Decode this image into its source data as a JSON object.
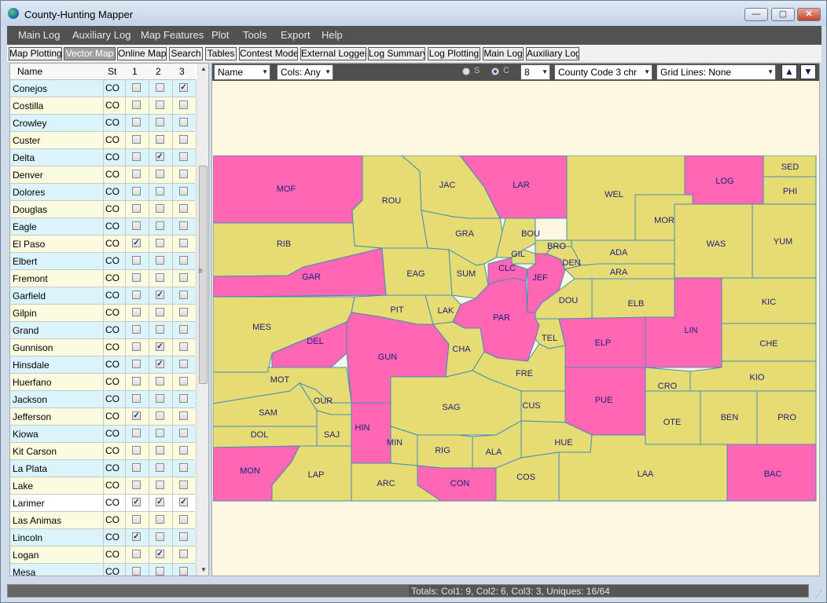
{
  "window": {
    "title": "County-Hunting Mapper",
    "min": "—",
    "max": "▢",
    "close": "✕"
  },
  "menu": [
    "Main Log",
    "Auxiliary Log",
    "Map Features",
    "Plot",
    "Tools",
    "Export",
    "Help"
  ],
  "tabs": [
    "Map Plotting",
    "Vector Map",
    "Online Map",
    "Search",
    "Tables",
    "Contest Mode",
    "External Logger",
    "Log Summary",
    "Log Plotting",
    "Main Log",
    "Auxiliary Log"
  ],
  "active_tab": "Vector Map",
  "table": {
    "headers": [
      "Name",
      "St",
      "1",
      "2",
      "3"
    ],
    "rows": [
      {
        "name": "Conejos",
        "st": "CO",
        "c1": false,
        "c2": false,
        "c3": true
      },
      {
        "name": "Costilla",
        "st": "CO",
        "c1": false,
        "c2": false,
        "c3": false
      },
      {
        "name": "Crowley",
        "st": "CO",
        "c1": false,
        "c2": false,
        "c3": false
      },
      {
        "name": "Custer",
        "st": "CO",
        "c1": false,
        "c2": false,
        "c3": false
      },
      {
        "name": "Delta",
        "st": "CO",
        "c1": false,
        "c2": true,
        "c3": false
      },
      {
        "name": "Denver",
        "st": "CO",
        "c1": false,
        "c2": false,
        "c3": false
      },
      {
        "name": "Dolores",
        "st": "CO",
        "c1": false,
        "c2": false,
        "c3": false
      },
      {
        "name": "Douglas",
        "st": "CO",
        "c1": false,
        "c2": false,
        "c3": false
      },
      {
        "name": "Eagle",
        "st": "CO",
        "c1": false,
        "c2": false,
        "c3": false
      },
      {
        "name": "El Paso",
        "st": "CO",
        "c1": true,
        "c2": false,
        "c3": false
      },
      {
        "name": "Elbert",
        "st": "CO",
        "c1": false,
        "c2": false,
        "c3": false
      },
      {
        "name": "Fremont",
        "st": "CO",
        "c1": false,
        "c2": false,
        "c3": false
      },
      {
        "name": "Garfield",
        "st": "CO",
        "c1": false,
        "c2": true,
        "c3": false
      },
      {
        "name": "Gilpin",
        "st": "CO",
        "c1": false,
        "c2": false,
        "c3": false
      },
      {
        "name": "Grand",
        "st": "CO",
        "c1": false,
        "c2": false,
        "c3": false
      },
      {
        "name": "Gunnison",
        "st": "CO",
        "c1": false,
        "c2": true,
        "c3": false
      },
      {
        "name": "Hinsdale",
        "st": "CO",
        "c1": false,
        "c2": true,
        "c3": false
      },
      {
        "name": "Huerfano",
        "st": "CO",
        "c1": false,
        "c2": false,
        "c3": false
      },
      {
        "name": "Jackson",
        "st": "CO",
        "c1": false,
        "c2": false,
        "c3": false
      },
      {
        "name": "Jefferson",
        "st": "CO",
        "c1": true,
        "c2": false,
        "c3": false
      },
      {
        "name": "Kiowa",
        "st": "CO",
        "c1": false,
        "c2": false,
        "c3": false
      },
      {
        "name": "Kit Carson",
        "st": "CO",
        "c1": false,
        "c2": false,
        "c3": false
      },
      {
        "name": "La Plata",
        "st": "CO",
        "c1": false,
        "c2": false,
        "c3": false
      },
      {
        "name": "Lake",
        "st": "CO",
        "c1": false,
        "c2": false,
        "c3": false
      },
      {
        "name": "Larimer",
        "st": "CO",
        "c1": true,
        "c2": true,
        "c3": true
      },
      {
        "name": "Las Animas",
        "st": "CO",
        "c1": false,
        "c2": false,
        "c3": false
      },
      {
        "name": "Lincoln",
        "st": "CO",
        "c1": true,
        "c2": false,
        "c3": false
      },
      {
        "name": "Logan",
        "st": "CO",
        "c1": false,
        "c2": true,
        "c3": false
      },
      {
        "name": "Mesa",
        "st": "CO",
        "c1": false,
        "c2": false,
        "c3": false
      }
    ]
  },
  "map_toolbar": {
    "name_dropdown": "Name",
    "cols_dropdown": "Cols: Any",
    "radio_s": "S",
    "radio_c": "C",
    "radio_selected": "C",
    "size_dropdown": "8",
    "code_dropdown": "County Code 3 chr",
    "grid_dropdown": "Grid Lines: None",
    "up_btn": "▲",
    "down_btn": "▼"
  },
  "colors": {
    "worked": "#ff66b3",
    "unworked": "#e6dc73",
    "border": "#3f8fb8",
    "label": "#1e1e7a",
    "map_bg": "#fdf7e2"
  },
  "map_counties": [
    "MOF",
    "ROU",
    "JAC",
    "LAR",
    "WEL",
    "LOG",
    "SED",
    "PHI",
    "MOR",
    "RIB",
    "GRA",
    "BOU",
    "BRO",
    "ADA",
    "WAS",
    "YUM",
    "GAR",
    "EAG",
    "SUM",
    "GIL",
    "CLC",
    "DEN",
    "JEF",
    "ARA",
    "MES",
    "PIT",
    "LAK",
    "DOU",
    "ELB",
    "KIC",
    "DEL",
    "PAR",
    "LIN",
    "GUN",
    "CHA",
    "TEL",
    "ELP",
    "CHE",
    "FRE",
    "MOT",
    "KIO",
    "OUR",
    "CUS",
    "PUE",
    "CRO",
    "SAG",
    "SAM",
    "SAJ",
    "HIN",
    "OTE",
    "BEN",
    "PRO",
    "DOL",
    "MIN",
    "RIG",
    "ALA",
    "HUE",
    "MON",
    "LAP",
    "ARC",
    "CON",
    "COS",
    "LAA",
    "BAC"
  ],
  "status": {
    "text": "Totals:   Col1: 9,   Col2: 6,   Col3: 3,   Uniques: 16/64"
  }
}
